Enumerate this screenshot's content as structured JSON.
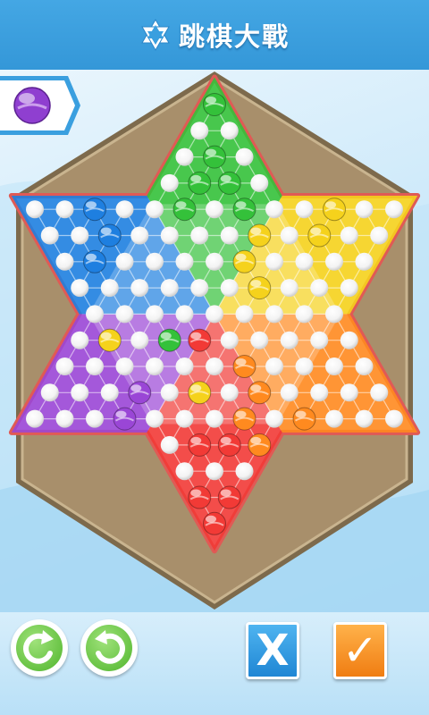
{
  "header": {
    "title": "跳棋大戰",
    "icon": "star-of-david-icon"
  },
  "turn_indicator": {
    "current_color": "purple",
    "icon": "purple-marble-icon"
  },
  "controls": {
    "undo_icon": "undo-arrow-icon",
    "redo_icon": "redo-arrow-icon",
    "cancel_label": "X",
    "confirm_label": "✓"
  },
  "colors": {
    "header_blue": "#3a9fdf",
    "board_frame": "#a88f6b",
    "star_border": "#e05a55",
    "green": "#34c13a",
    "yellow": "#f5d21c",
    "orange": "#ff8a1f",
    "red": "#f23a36",
    "purple": "#9a46d6",
    "blue": "#1e7fe0"
  },
  "board": {
    "marbles": {
      "green": [
        [
          0,
          0
        ],
        [
          1,
          0
        ],
        [
          2,
          0
        ],
        [
          3,
          -1
        ],
        [
          3,
          1
        ],
        [
          4,
          -2
        ],
        [
          4,
          1
        ],
        [
          4,
          2
        ],
        [
          5,
          -2
        ],
        [
          9,
          -3
        ]
      ],
      "yellow": [
        [
          4,
          5
        ],
        [
          4,
          7
        ],
        [
          4,
          8
        ],
        [
          5,
          3
        ],
        [
          5,
          7
        ],
        [
          5,
          8
        ],
        [
          6,
          2
        ],
        [
          6,
          5
        ],
        [
          7,
          2
        ],
        [
          7,
          3
        ]
      ],
      "orange": [
        [
          10,
          2
        ],
        [
          9,
          4
        ],
        [
          11,
          3
        ],
        [
          12,
          2
        ],
        [
          12,
          3
        ],
        [
          12,
          6
        ],
        [
          13,
          3
        ],
        [
          13,
          4
        ],
        [
          14,
          3
        ],
        [
          14,
          4
        ]
      ],
      "red": [
        [
          9,
          -1
        ],
        [
          13,
          -1
        ],
        [
          13,
          1
        ],
        [
          15,
          -2
        ],
        [
          15,
          -1
        ],
        [
          15,
          1
        ],
        [
          15,
          2
        ],
        [
          16,
          -1
        ],
        [
          16,
          0
        ],
        [
          16,
          2
        ],
        [
          17,
          0
        ]
      ],
      "purple": [
        [
          6,
          -3
        ],
        [
          11,
          -2
        ],
        [
          11,
          -5
        ],
        [
          12,
          -5
        ],
        [
          12,
          -6
        ],
        [
          12,
          -3
        ],
        [
          13,
          -4
        ],
        [
          14,
          -4
        ],
        [
          14,
          -6
        ],
        [
          14,
          -8
        ]
      ],
      "blue": [
        [
          4,
          -8
        ],
        [
          4,
          -7
        ],
        [
          4,
          -5
        ],
        [
          5,
          -7
        ],
        [
          6,
          -8
        ],
        [
          8,
          -5
        ],
        [
          8,
          -1
        ],
        [
          8,
          1
        ],
        [
          12,
          5
        ],
        [
          14,
          1
        ]
      ],
      "mixed_yellow_on_left": [
        [
          9,
          -7
        ],
        [
          11,
          -1
        ]
      ],
      "mixed_green": [
        [
          13,
          -2
        ]
      ],
      "extra_red": [
        [
          7,
          -2
        ]
      ],
      "extra_orange": [
        [
          11,
          0
        ]
      ]
    }
  }
}
